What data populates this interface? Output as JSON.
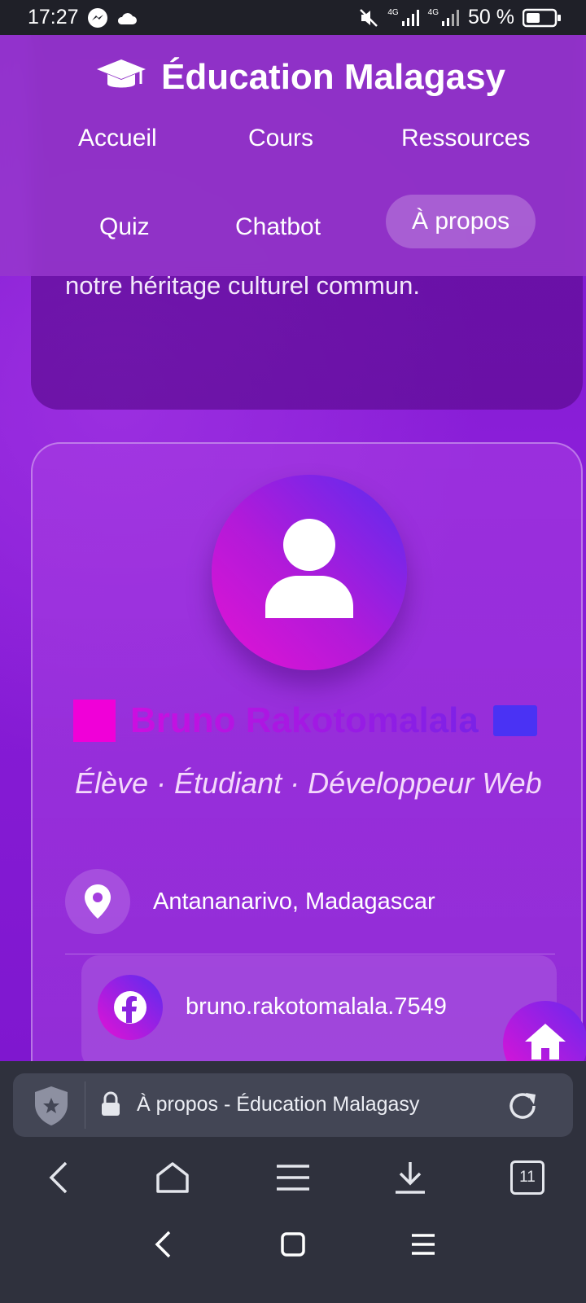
{
  "status_bar": {
    "time": "17:27",
    "network_type_1": "4G",
    "network_type_2": "4G",
    "battery": "50 %"
  },
  "header": {
    "brand_icon": "graduation-cap-icon",
    "title": "Éducation Malagasy",
    "nav": [
      {
        "label": "Accueil"
      },
      {
        "label": "Cours"
      },
      {
        "label": "Ressources"
      },
      {
        "label": "Quiz"
      },
      {
        "label": "Chatbot"
      },
      {
        "label": "À propos",
        "active": true
      }
    ]
  },
  "intro": {
    "text_tail": "notre héritage culturel commun."
  },
  "profile": {
    "name": "Bruno Rakotomalala",
    "role": "Élève · Étudiant · Développeur Web",
    "location": "Antananarivo, Madagascar",
    "facebook": "bruno.rakotomalala.7549"
  },
  "browser": {
    "url_title": "À propos - Éducation Malagasy",
    "tabs_count": "11"
  },
  "colors": {
    "page_purple": "#8a1ed8",
    "accent_pink": "#e312d4",
    "accent_blue": "#5a2cf0",
    "chrome_dark": "#2f313d"
  }
}
